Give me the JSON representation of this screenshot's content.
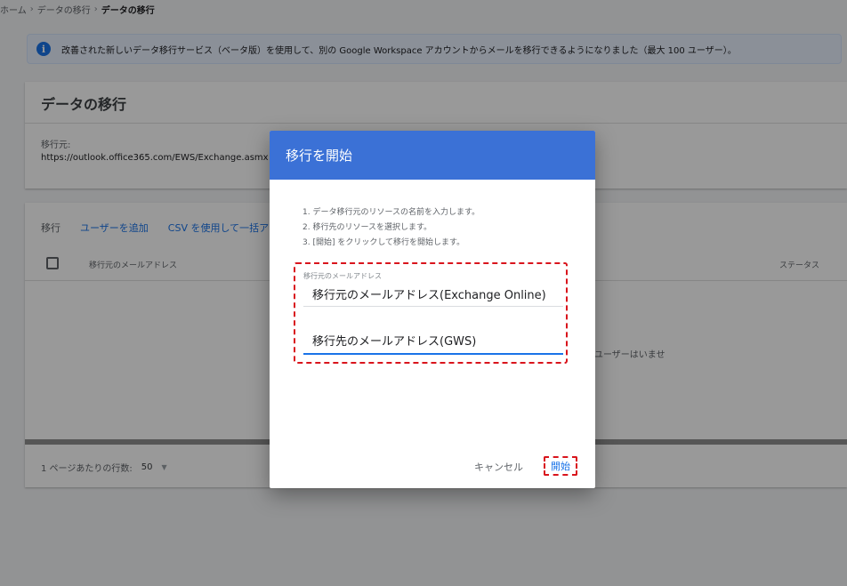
{
  "breadcrumb": {
    "home": "ホーム",
    "separator": "›",
    "parent": "データの移行",
    "current": "データの移行"
  },
  "banner": {
    "icon": "info-icon",
    "text": "改善された新しいデータ移行サービス（ベータ版）を使用して、別の Google Workspace アカウントからメールを移行できるようになりました（最大 100 ユーザー）。"
  },
  "migration_card": {
    "title": "データの移行",
    "source_label": "移行元:",
    "source_url": "https://outlook.office365.com/EWS/Exchange.asmx"
  },
  "users_card": {
    "tab_migrate": "移行",
    "add_user": "ユーザーを追加",
    "csv_upload": "CSV を使用して一括アップロード",
    "col_source_email": "移行元のメールアドレス",
    "col_status": "ステータス",
    "empty_text": "ユーザーはいませ",
    "rows_per_page_label": "1 ページあたりの行数:",
    "rows_per_page_value": "50",
    "rows_caret": "▼"
  },
  "dialog": {
    "title": "移行を開始",
    "steps": [
      "1. データ移行元のリソースの名前を入力します。",
      "2. 移行先のリソースを選択します。",
      "3. [開始] をクリックして移行を開始します。"
    ],
    "source_field_label": "移行元のメールアドレス",
    "source_field_value": "移行元のメールアドレス(Exchange Online)",
    "dest_field_value": "移行先のメールアドレス(GWS)",
    "cancel_label": "キャンセル",
    "start_label": "開始"
  },
  "colors": {
    "header_blue": "#3b71d6",
    "accent_blue": "#1a73e8",
    "highlight_red": "#d9141c",
    "banner_bg": "#e8f0fe"
  }
}
